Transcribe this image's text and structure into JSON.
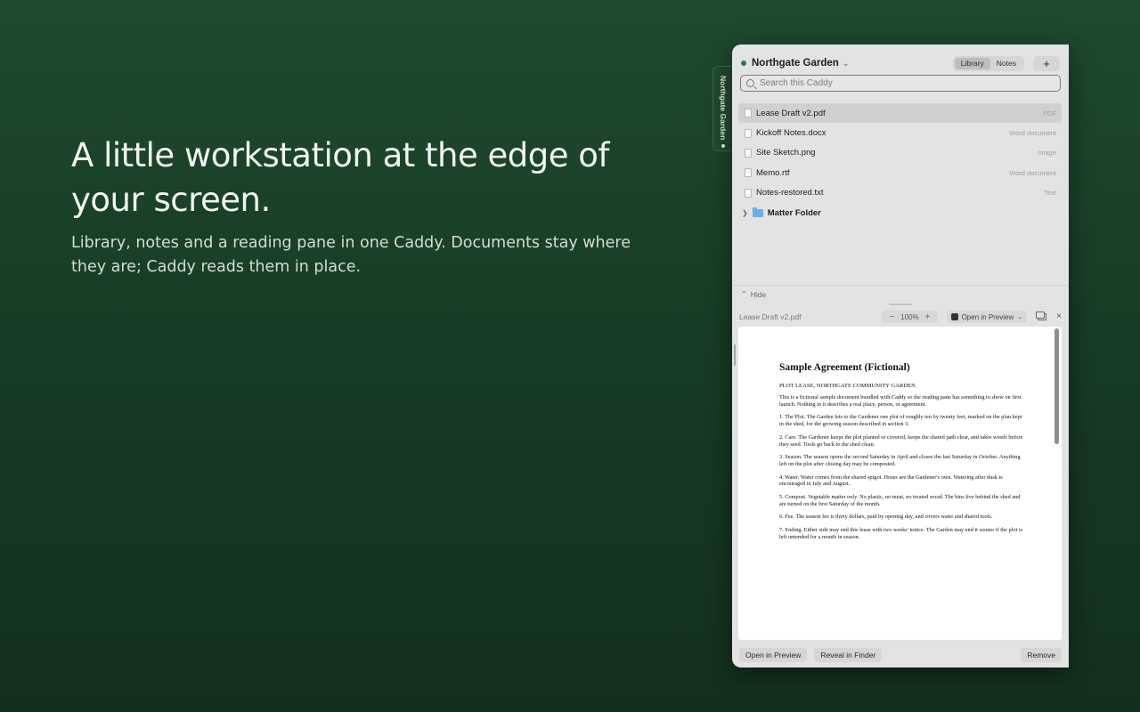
{
  "hero": {
    "title": "A little workstation at the edge of your screen.",
    "subtitle": "Library, notes and a reading pane in one Caddy. Documents stay where they are; Caddy reads them in place."
  },
  "tab_handle": {
    "label": "Northgate Garden"
  },
  "header": {
    "caddy_name": "Northgate Garden",
    "tabs": [
      "Library",
      "Notes"
    ],
    "active_tab": "Library",
    "add_label": "+"
  },
  "search": {
    "placeholder": "Search this Caddy",
    "value": ""
  },
  "files": [
    {
      "name": "Lease Draft v2.pdf",
      "kind": "PDF",
      "selected": true
    },
    {
      "name": "Kickoff Notes.docx",
      "kind": "Word document"
    },
    {
      "name": "Site Sketch.png",
      "kind": "Image"
    },
    {
      "name": "Memo.rtf",
      "kind": "Word document"
    },
    {
      "name": "Notes-restored.txt",
      "kind": "Text"
    }
  ],
  "folder": {
    "name": "Matter Folder"
  },
  "hide_label": "Hide",
  "reader": {
    "file_name": "Lease Draft v2.pdf",
    "zoom": "100%",
    "zoom_out": "−",
    "zoom_in": "+",
    "open_in": "Open in Preview",
    "close": "×"
  },
  "document": {
    "title": "Sample Agreement (Fictional)",
    "subtitle": "PLOT LEASE, NORTHGATE COMMUNITY GARDEN",
    "paragraphs": [
      "This is a fictional sample document bundled with Caddy so the reading pane has something to show on first launch. Nothing in it describes a real place, person, or agreement.",
      "1. The Plot. The Garden lets to the Gardener one plot of roughly ten by twenty feet, marked on the plan kept in the shed, for the growing season described in section 3.",
      "2. Care. The Gardener keeps the plot planted or covered, keeps the shared path clear, and takes weeds before they seed. Tools go back to the shed clean.",
      "3. Season. The season opens the second Saturday in April and closes the last Saturday in October. Anything left on the plot after closing day may be composted.",
      "4. Water. Water comes from the shared spigot. Hoses are the Gardener's own. Watering after dusk is encouraged in July and August.",
      "5. Compost. Vegetable matter only. No plastic, no meat, no treated wood. The bins live behind the shed and are turned on the first Saturday of the month.",
      "6. Fee. The season fee is thirty dollars, paid by opening day, and covers water and shared tools.",
      "7. Ending. Either side may end this lease with two weeks' notice. The Garden may end it sooner if the plot is left untended for a month in season."
    ]
  },
  "footer": {
    "open_preview": "Open in Preview",
    "reveal": "Reveal in Finder",
    "remove": "Remove"
  },
  "colors": {
    "background": "#1e4a2e",
    "panel": "#e3e3e3",
    "status_dot": "#2c7a3f",
    "folder": "#6aaee8"
  }
}
